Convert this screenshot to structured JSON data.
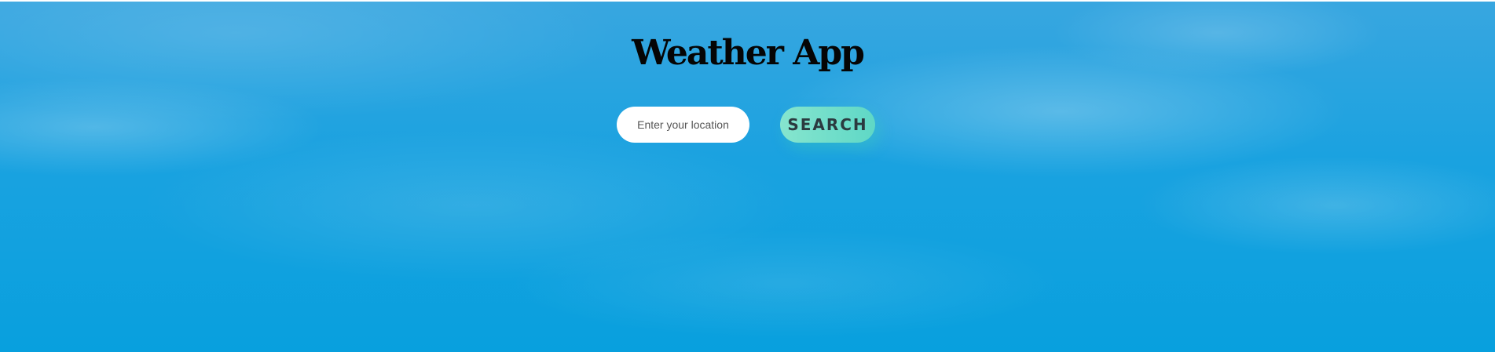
{
  "header": {
    "title": "Weather App"
  },
  "search": {
    "placeholder": "Enter your location",
    "value": "",
    "button_label": "SEARCH"
  },
  "colors": {
    "background": "#02a0df",
    "button_gradient_start": "#86e5ce",
    "button_gradient_end": "#5fd8c6",
    "title_color": "#050505"
  }
}
